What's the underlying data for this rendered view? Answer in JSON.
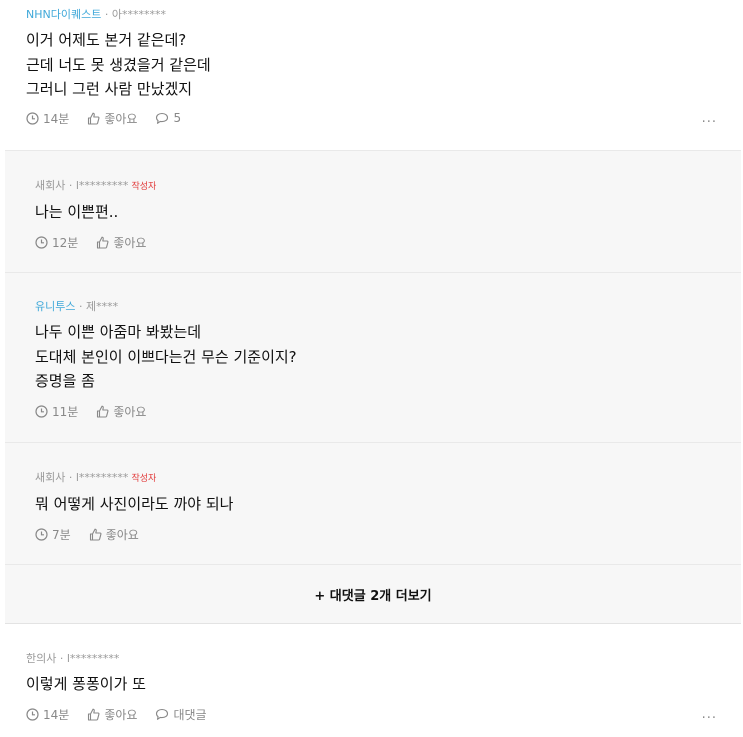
{
  "comments": [
    {
      "company": "NHN다이퀘스트",
      "separator": " · ",
      "user": "아********",
      "lines": [
        "이거 어제도 본거 같은데?",
        "근데 너도 못 생겼을거 같은데",
        "그러니 그런 사람 만났겠지"
      ],
      "time": "14분",
      "like": "좋아요",
      "reply": "5",
      "more": "..."
    }
  ],
  "replies": [
    {
      "company": "새회사",
      "separator": " · ",
      "user": "l*********",
      "author_tag": "작성자",
      "lines": [
        "나는 이쁜편.."
      ],
      "time": "12분",
      "like": "좋아요"
    },
    {
      "company": "유니투스",
      "separator": " · ",
      "user": "제****",
      "lines": [
        "나두 이쁜 아줌마 봐봤는데",
        "도대체 본인이 이쁘다는건 무슨 기준이지?",
        "증명을 좀"
      ],
      "time": "11분",
      "like": "좋아요"
    },
    {
      "company": "새회사",
      "separator": " · ",
      "user": "l*********",
      "author_tag": "작성자",
      "lines": [
        "뭐 어떻게 사진이라도 까야 되나"
      ],
      "time": "7분",
      "like": "좋아요"
    }
  ],
  "more_replies": "+ 대댓글 2개 더보기",
  "second": {
    "company": "한의사",
    "separator": " · ",
    "user": "l*********",
    "lines": [
      "이렇게 퐁퐁이가 또"
    ],
    "time": "14분",
    "like": "좋아요",
    "reply": "대댓글",
    "more": "..."
  },
  "colors": {
    "company_link": "#3fa8d9",
    "author_tag": "#e23b3b",
    "reply_bg": "#f7f7f7"
  }
}
